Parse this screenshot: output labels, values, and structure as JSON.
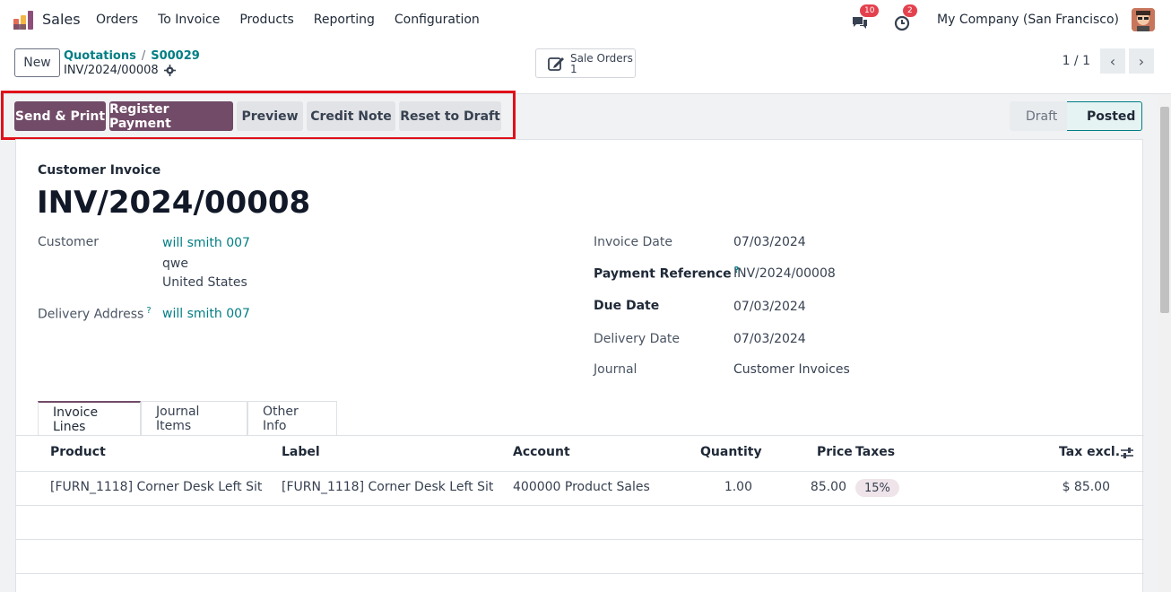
{
  "nav": {
    "app_name": "Sales",
    "menu": [
      "Orders",
      "To Invoice",
      "Products",
      "Reporting",
      "Configuration"
    ],
    "chat_count": "10",
    "activity_count": "2",
    "company": "My Company (San Francisco)"
  },
  "control": {
    "new_label": "New",
    "breadcrumbs": [
      "Quotations",
      "S00029"
    ],
    "record_name": "INV/2024/00008",
    "smart_button": {
      "label": "Sale Orders",
      "count": "1"
    },
    "pager": "1 / 1"
  },
  "actions": [
    "Send & Print",
    "Register Payment",
    "Preview",
    "Credit Note",
    "Reset to Draft"
  ],
  "status": {
    "draft": "Draft",
    "posted": "Posted"
  },
  "invoice": {
    "doc_type": "Customer Invoice",
    "name": "INV/2024/00008",
    "customer_label": "Customer",
    "customer_name": "will smith 007",
    "address_line1": "qwe",
    "address_line2": "United States",
    "delivery_address_label": "Delivery Address",
    "delivery_address_value": "will smith 007",
    "invoice_date_label": "Invoice Date",
    "invoice_date": "07/03/2024",
    "payment_ref_label": "Payment Reference",
    "payment_ref": "INV/2024/00008",
    "due_date_label": "Due Date",
    "due_date": "07/03/2024",
    "delivery_date_label": "Delivery Date",
    "delivery_date": "07/03/2024",
    "journal_label": "Journal",
    "journal": "Customer Invoices",
    "help_mark": "?"
  },
  "tabs": [
    "Invoice Lines",
    "Journal Items",
    "Other Info"
  ],
  "table": {
    "headers": [
      "Product",
      "Label",
      "Account",
      "Quantity",
      "Price",
      "Taxes",
      "Tax excl."
    ],
    "rows": [
      {
        "product": "[FURN_1118] Corner Desk Left Sit",
        "label": "[FURN_1118] Corner Desk Left Sit",
        "account": "400000 Product Sales",
        "quantity": "1.00",
        "price": "85.00",
        "taxes": "15%",
        "tax_excl": "$ 85.00"
      }
    ]
  },
  "colors": {
    "brand": "#714b67",
    "link": "#017e84",
    "highlight": "#e0101a"
  }
}
